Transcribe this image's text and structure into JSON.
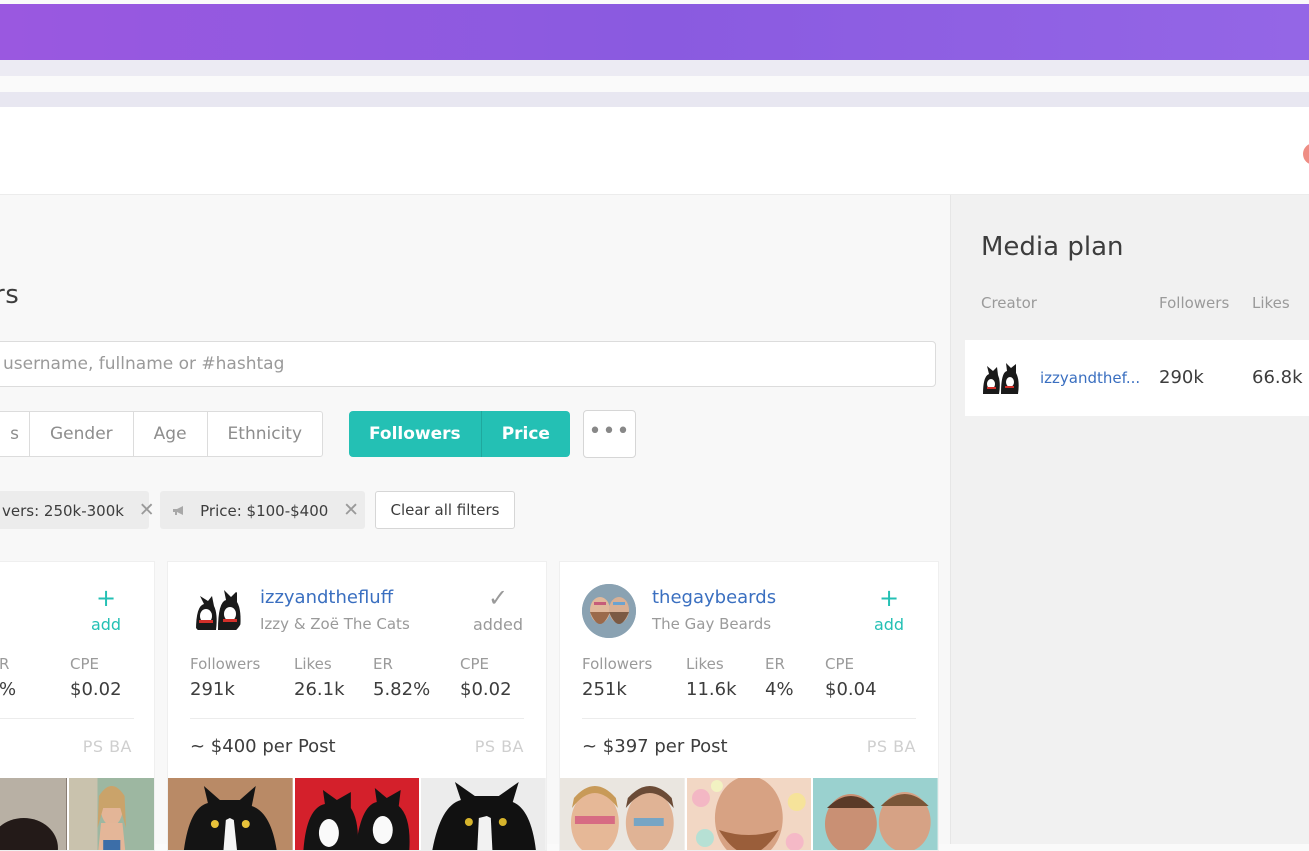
{
  "page": {
    "title": "rs",
    "search_placeholder": "username, fullname or #hashtag"
  },
  "filters": {
    "white": [
      "s",
      "Gender",
      "Age",
      "Ethnicity"
    ],
    "active": [
      "Followers",
      "Price"
    ],
    "more": "•••"
  },
  "chips": [
    {
      "label": "vers: 250k-300k",
      "close": "✕"
    },
    {
      "label": "Price: $100-$400",
      "close": "✕",
      "icon": "megaphone-icon"
    }
  ],
  "clear_all": "Clear all filters",
  "cards": [
    {
      "action_symbol": "+",
      "action_label": "add",
      "stats": [
        {
          "k": "R",
          "v": "%"
        },
        {
          "k": "CPE",
          "v": "$0.02"
        }
      ],
      "badges": "PS  BA"
    },
    {
      "username": "izzyandthefluff",
      "fullname": "Izzy & Zoë The Cats",
      "action_symbol": "✓",
      "action_label": "added",
      "stats": [
        {
          "k": "Followers",
          "v": "291k"
        },
        {
          "k": "Likes",
          "v": "26.1k"
        },
        {
          "k": "ER",
          "v": "5.82%"
        },
        {
          "k": "CPE",
          "v": "$0.02"
        }
      ],
      "price": "~ $400 per Post",
      "badges": "PS  BA"
    },
    {
      "username": "thegaybeards",
      "fullname": "The Gay Beards",
      "action_symbol": "+",
      "action_label": "add",
      "stats": [
        {
          "k": "Followers",
          "v": "251k"
        },
        {
          "k": "Likes",
          "v": "11.6k"
        },
        {
          "k": "ER",
          "v": "4%"
        },
        {
          "k": "CPE",
          "v": "$0.04"
        }
      ],
      "price": "~ $397 per Post",
      "badges": "PS  BA"
    }
  ],
  "media_plan": {
    "title": "Media plan",
    "headers": [
      "Creator",
      "Followers",
      "Likes"
    ],
    "rows": [
      {
        "creator": "izzyandthef...",
        "followers": "290k",
        "likes": "66.8k"
      }
    ]
  },
  "colors": {
    "accent_teal": "#24c0b4",
    "top_bar_purple": "#9a58e0",
    "link_blue": "#3a6fc0"
  }
}
